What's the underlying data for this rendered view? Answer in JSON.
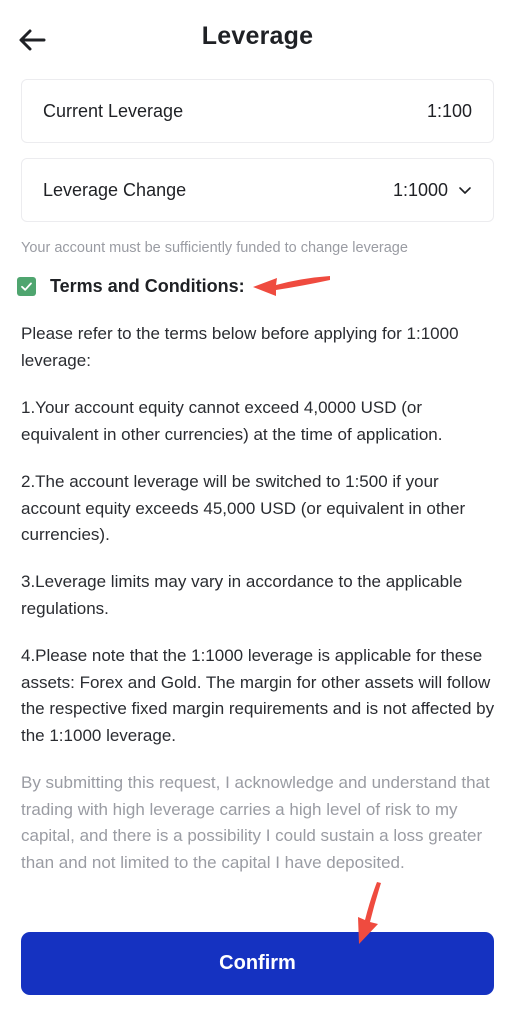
{
  "header": {
    "title": "Leverage",
    "back_icon": "arrow-left-icon"
  },
  "current_leverage": {
    "label": "Current Leverage",
    "value": "1:100"
  },
  "leverage_change": {
    "label": "Leverage Change",
    "value": "1:1000",
    "icon": "chevron-down-icon"
  },
  "hint": "Your account must be sufficiently funded to change leverage",
  "terms": {
    "checked": true,
    "label": "Terms and Conditions:"
  },
  "content": {
    "intro": "Please refer to the terms below before applying for 1:1000 leverage:",
    "items": [
      "1.Your account equity cannot exceed 4,0000 USD (or equivalent in other currencies) at the time of application.",
      "2.The account leverage will be switched to 1:500 if your account equity exceeds 45,000 USD (or equivalent in other currencies).",
      "3.Leverage limits may vary in accordance to the applicable regulations.",
      "4.Please note that the 1:1000 leverage is applicable for these assets: Forex and Gold. The margin for other assets will follow the respective fixed margin requirements and is not affected by the 1:1000 leverage."
    ],
    "disclaimer": "By submitting this request, I acknowledge and understand that trading with high leverage carries a high level of risk to my capital, and there is a possibility I could sustain a loss greater than and not limited to the capital I have deposited."
  },
  "confirm_label": "Confirm",
  "colors": {
    "primary": "#1532c1",
    "checkbox": "#4fa56f",
    "annotation_arrow": "#ef4b3f",
    "muted_text": "#9a9ca3"
  }
}
